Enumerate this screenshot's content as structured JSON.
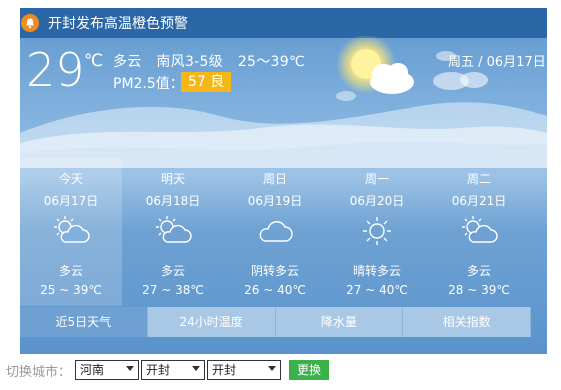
{
  "alert": {
    "text": "开封发布高温橙色预警",
    "icon": "bell-icon"
  },
  "current": {
    "temp": "29",
    "unit": "℃",
    "condition": "多云",
    "wind": "南风3-5级",
    "range": "25～39℃",
    "aqi_label": "PM2.5值：",
    "aqi_value": "57 良",
    "date": "周五 / 06月17日"
  },
  "forecast": [
    {
      "name": "今天",
      "date": "06月17日",
      "icon": "partly-cloudy-icon",
      "desc": "多云",
      "range": "25 ~ 39℃"
    },
    {
      "name": "明天",
      "date": "06月18日",
      "icon": "partly-cloudy-icon",
      "desc": "多云",
      "range": "27 ~ 38℃"
    },
    {
      "name": "周日",
      "date": "06月19日",
      "icon": "cloudy-icon",
      "desc": "阴转多云",
      "range": "26 ~ 40℃"
    },
    {
      "name": "周一",
      "date": "06月20日",
      "icon": "sunny-icon",
      "desc": "晴转多云",
      "range": "27 ~ 40℃"
    },
    {
      "name": "周二",
      "date": "06月21日",
      "icon": "partly-cloudy-icon",
      "desc": "多云",
      "range": "28 ~ 39℃"
    }
  ],
  "tabs": [
    {
      "label": "近5日天气"
    },
    {
      "label": "24小时温度"
    },
    {
      "label": "降水量"
    },
    {
      "label": "相关指数"
    }
  ],
  "switcher": {
    "label": "切换城市：",
    "province": "河南",
    "city": "开封",
    "district": "开封",
    "button": "更换"
  },
  "colors": {
    "accent_alert": "#f08a24",
    "aqi_badge": "#f5b617",
    "button": "#3bb14a",
    "alert_bar": "#2b67a6"
  }
}
